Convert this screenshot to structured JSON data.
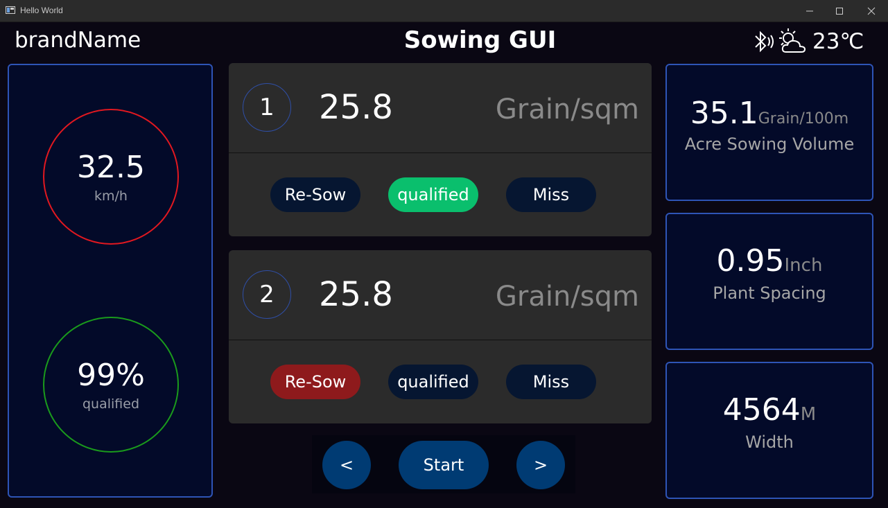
{
  "window": {
    "title": "Hello World"
  },
  "header": {
    "brand": "brandName",
    "title": "Sowing GUI",
    "temperature": "23℃"
  },
  "left_panel": {
    "speed": {
      "value": "32.5",
      "unit": "km/h",
      "color": "#e21820"
    },
    "quality": {
      "value": "99%",
      "unit": "qualified",
      "color": "#1a9b1c"
    }
  },
  "rows": [
    {
      "index": "1",
      "value": "25.8",
      "unit": "Grain/sqm",
      "buttons": [
        "Re-Sow",
        "qualified",
        "Miss"
      ],
      "active": "qualified",
      "active_color": "#0abf6d"
    },
    {
      "index": "2",
      "value": "25.8",
      "unit": "Grain/sqm",
      "buttons": [
        "Re-Sow",
        "qualified",
        "Miss"
      ],
      "active": "Re-Sow",
      "active_color": "#8e1a1c"
    }
  ],
  "nav": {
    "prev": "<",
    "start": "Start",
    "next": ">"
  },
  "stats": [
    {
      "value": "35.1",
      "unit": "Grain/100m",
      "label": "Acre Sowing Volume"
    },
    {
      "value": "0.95",
      "unit": "Inch",
      "label": "Plant Spacing"
    },
    {
      "value": "4564",
      "unit": "M",
      "label": "Width"
    }
  ],
  "icons": [
    "bluetooth-icon",
    "partly-cloudy-icon",
    "minimize-icon",
    "maximize-icon",
    "close-icon"
  ]
}
